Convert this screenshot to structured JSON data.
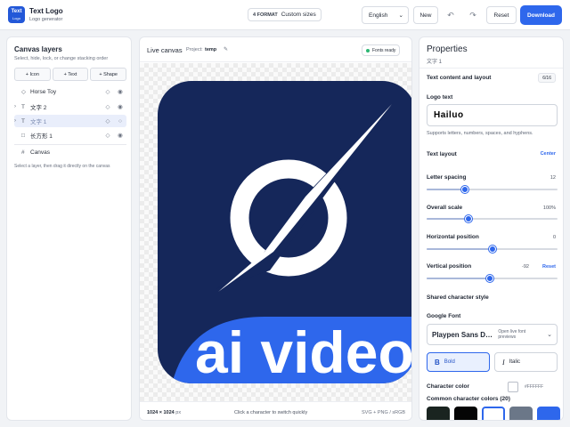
{
  "header": {
    "logo_line1": "Text",
    "logo_line2": "Logo",
    "title": "Text Logo",
    "subtitle": "Logo generator",
    "format_count": "4 FORMAT",
    "format_label": "Custom sizes",
    "language": "English",
    "new_label": "New",
    "undo_icon": "undo-icon",
    "redo_icon": "redo-icon",
    "reset_label": "Reset",
    "download_label": "Download"
  },
  "layers_panel": {
    "title": "Canvas layers",
    "hint": "Select, hide, lock, or change stacking order",
    "add_icon": "+ Icon",
    "add_text": "+ Text",
    "add_shape": "+ Shape",
    "layers": [
      {
        "name": "Horse Toy",
        "type_glyph": "◇",
        "chevron": ""
      },
      {
        "name": "文字 2",
        "type_glyph": "T",
        "chevron": "›"
      },
      {
        "name": "文字 1",
        "type_glyph": "T",
        "chevron": "›"
      },
      {
        "name": "长方形 1",
        "type_glyph": "□",
        "chevron": ""
      }
    ],
    "canvas_item": {
      "glyph": "#",
      "name": "Canvas"
    },
    "tip": "Select a layer, then drag it directly on the canvas"
  },
  "canvas_panel": {
    "title": "Live canvas",
    "project_label": "Project:",
    "project_name": "temp",
    "edit_glyph": "✎",
    "fonts_status": "Fonts ready",
    "logo_text": "ai video",
    "size_value": "1024 × 1024",
    "size_unit": "px",
    "hint": "Click a character to switch quickly",
    "export_formats": "SVG + PNG / sRGB",
    "colors": {
      "tile": "#15275a",
      "banner": "#2e67ec",
      "mark": "#ffffff"
    }
  },
  "properties": {
    "title": "Properties",
    "subtitle": "文字 1",
    "section_text": "Text content and layout",
    "section_badge": "6/16",
    "logo_text_label": "Logo text",
    "logo_text_value": "Hailuo",
    "logo_text_note": "Supports letters, numbers, spaces, and hyphens.",
    "text_layout_label": "Text layout",
    "text_layout_value": "Center",
    "letter_spacing_label": "Letter spacing",
    "letter_spacing_value": "12",
    "letter_spacing_fraction": 0.29,
    "overall_scale_label": "Overall scale",
    "overall_scale_value": "100%",
    "overall_scale_fraction": 0.32,
    "horizontal_label": "Horizontal position",
    "horizontal_value": "0",
    "horizontal_fraction": 0.5,
    "vertical_label": "Vertical position",
    "vertical_value": "-92",
    "vertical_reset": "Reset",
    "vertical_fraction": 0.48,
    "shared_style_label": "Shared character style",
    "google_font_label": "Google Font",
    "font_name": "Playpen Sans Deva",
    "font_hint": "Open live font previews",
    "bold_label": "Bold",
    "italic_label": "Italic",
    "char_color_label": "Character color",
    "char_color_hex": "#FFFFFF",
    "common_colors_label": "Common character colors (20)",
    "common_colors": [
      "#1a2420",
      "#050505",
      "#ffffff",
      "#6b7788",
      "#2e67ec"
    ],
    "selected_color_index": 2
  }
}
